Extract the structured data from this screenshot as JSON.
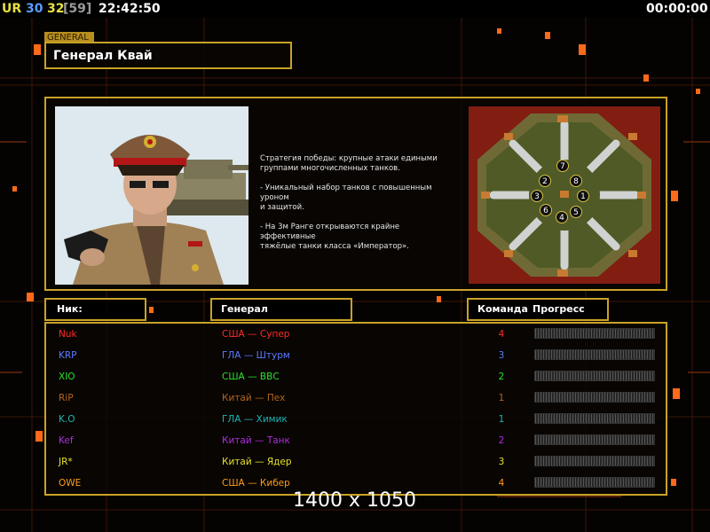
{
  "hud": {
    "ur_label": "UR",
    "value_a": "30",
    "value_b": "32",
    "value_c": "[59]",
    "clock": "22:42:50",
    "timer": "00:00:00"
  },
  "general": {
    "tag": "GENERAL",
    "name": "Генерал Квай",
    "description": "Стратегия победы: крупные атаки едиными\n группами многочисленных танков.\n\n- Уникальный набор танков с повышенным уроном\n  и защитой.\n\n- На 3м Ранге открываются крайне эффективные\n  тяжёлые танки класса «Император»."
  },
  "map": {
    "slots": [
      "1",
      "2",
      "3",
      "4",
      "5",
      "6",
      "7",
      "8"
    ]
  },
  "columns": {
    "nick": "Ник:",
    "general": "Генерал",
    "team": "Команда",
    "progress": "Прогресс"
  },
  "players": [
    {
      "nick": "Nuk",
      "general": "США — Супер",
      "team": "4",
      "color": "#ff2a2a",
      "progress": 0
    },
    {
      "nick": "KRP",
      "general": "ГЛА — Штурм",
      "team": "3",
      "color": "#5a7bff",
      "progress": 0
    },
    {
      "nick": "XIO",
      "general": "США — ВВС",
      "team": "2",
      "color": "#2ee02e",
      "progress": 0
    },
    {
      "nick": "RiP",
      "general": "Китай — Пех",
      "team": "1",
      "color": "#b5651d",
      "progress": 0
    },
    {
      "nick": "K.O",
      "general": "ГЛА — Химик",
      "team": "1",
      "color": "#1fb5b5",
      "progress": 0
    },
    {
      "nick": "Kef",
      "general": "Китай — Танк",
      "team": "2",
      "color": "#b02ce0",
      "progress": 0
    },
    {
      "nick": "JR*",
      "general": "Китай — Ядер",
      "team": "3",
      "color": "#e8e02a",
      "progress": 0
    },
    {
      "nick": "OWE",
      "general": "США — Кибер",
      "team": "4",
      "color": "#ff9a1a",
      "progress": 0
    }
  ],
  "resolution": "1400 x 1050",
  "colors": {
    "frame": "#c9a227",
    "background": "#050302"
  }
}
